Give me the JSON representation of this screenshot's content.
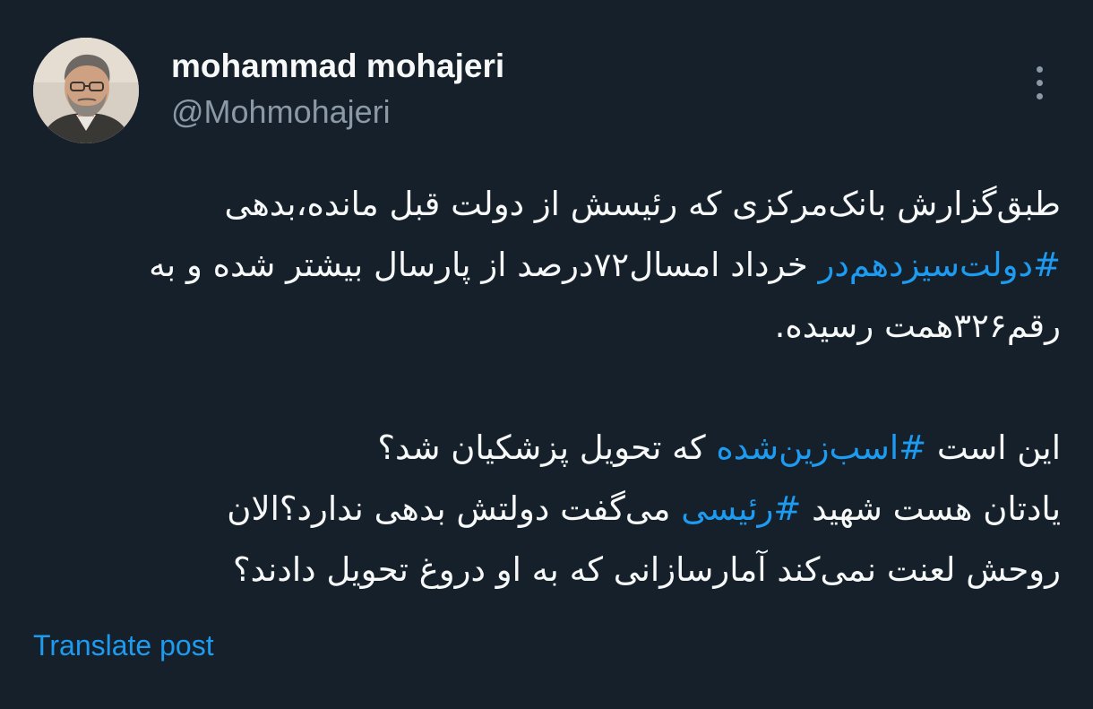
{
  "author": {
    "name": "mohammad mohajeri",
    "handle": "@Mohmohajeri"
  },
  "tweet": {
    "line1": "طبق‌گزارش بانک‌مرکزی که رئیسش از دولت قبل مانده،بدهی",
    "line2_hashtag": "#دولت‌سیزدهم‌در",
    "line2_rest": " خرداد امسال۷۲درصد از پارسال بیشتر شده و به",
    "line3": "رقم۳۲۶همت رسیده.",
    "line4_start": "این است ",
    "line4_hashtag": "#اسب‌زین‌شده",
    "line4_end": " که تحویل پزشکیان شد؟",
    "line5_start": "یادتان هست شهید ",
    "line5_hashtag": "#رئیسی",
    "line5_end": " می‌گفت دولتش بدهی ندارد؟الان",
    "line6": "روحش لعنت نمی‌کند آمارسازانی که به او دروغ تحویل دادند؟"
  },
  "actions": {
    "translate_label": "Translate post",
    "more_icon": "more-vertical-icon"
  },
  "colors": {
    "background": "#15202b",
    "text": "#f7f9f9",
    "muted": "#8b98a5",
    "accent": "#1d9bf0"
  }
}
